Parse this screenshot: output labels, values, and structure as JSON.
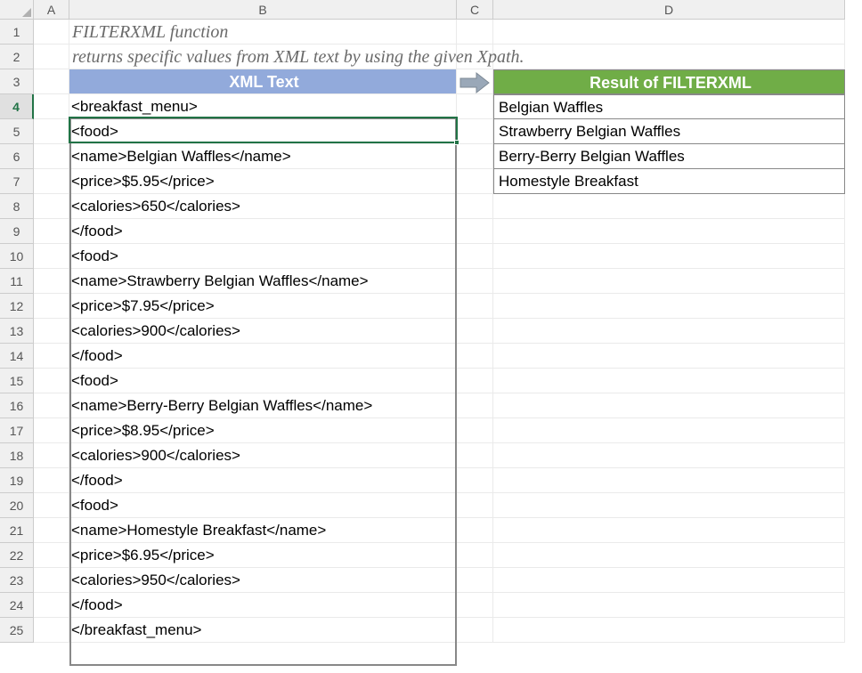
{
  "columns": [
    "A",
    "B",
    "C",
    "D"
  ],
  "rows": [
    "1",
    "2",
    "3",
    "4",
    "5",
    "6",
    "7",
    "8",
    "9",
    "10",
    "11",
    "12",
    "13",
    "14",
    "15",
    "16",
    "17",
    "18",
    "19",
    "20",
    "21",
    "22",
    "23",
    "24",
    "25"
  ],
  "title1": "FILTERXML function",
  "title2": "returns specific values from XML text by using the given Xpath.",
  "xml_header": "XML Text",
  "result_header": "Result of FILTERXML",
  "xml_lines": [
    "<breakfast_menu>",
    "<food>",
    "<name>Belgian Waffles</name>",
    "<price>$5.95</price>",
    "<calories>650</calories>",
    "</food>",
    "<food>",
    "<name>Strawberry Belgian Waffles</name>",
    "<price>$7.95</price>",
    "<calories>900</calories>",
    "</food>",
    "<food>",
    "<name>Berry-Berry Belgian Waffles</name>",
    "<price>$8.95</price>",
    "<calories>900</calories>",
    "</food>",
    "<food>",
    "<name>Homestyle Breakfast</name>",
    "<price>$6.95</price>",
    "<calories>950</calories>",
    "</food>",
    "</breakfast_menu>"
  ],
  "results": [
    "Belgian Waffles",
    "Strawberry Belgian Waffles",
    "Berry-Berry Belgian Waffles",
    "Homestyle Breakfast"
  ],
  "selected_row": "4"
}
